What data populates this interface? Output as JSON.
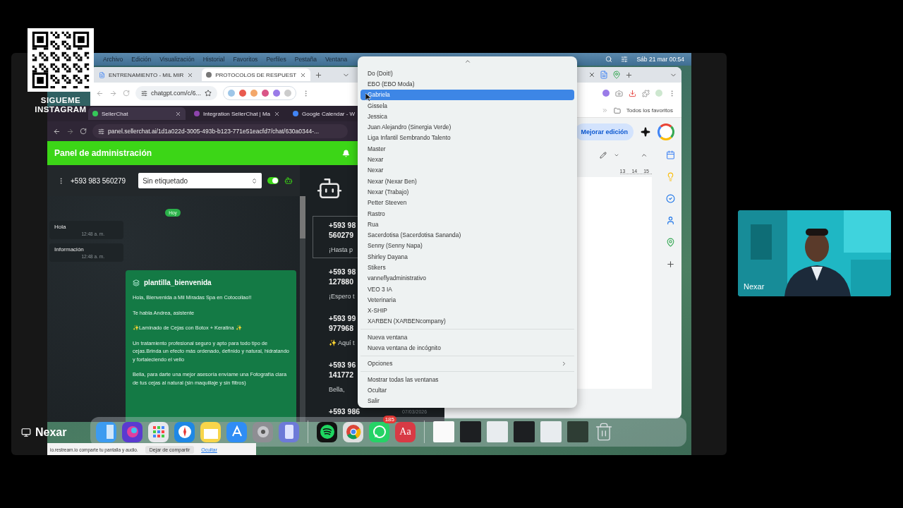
{
  "overlay": {
    "qr_caption": "SIGUEME INSTAGRAM",
    "presenter": "Nexar",
    "webcam": {
      "kind": "picture",
      "name_tag": "Nexar"
    }
  },
  "menu_bar": {
    "items": [
      "Archivo",
      "Edición",
      "Visualización",
      "Historial",
      "Favoritos",
      "Perfiles",
      "Pestaña",
      "Ventana"
    ],
    "clock": "Sáb 21 mar  00:54"
  },
  "back_browser": {
    "tabs": [
      {
        "label": "ENTRENAMIENTO - MIL MIR",
        "selected": false
      },
      {
        "label": "PROTOCOLOS DE RESPUEST",
        "selected": true
      }
    ],
    "url": "chatgpt.com/c/6...",
    "bookmarks": "Todos los favoritos",
    "doc_button": "Mejorar edición",
    "ruler": [
      "13",
      "14",
      "15"
    ]
  },
  "front_browser": {
    "tabs": [
      {
        "label": "SellerChat",
        "selected": true
      },
      {
        "label": "Integration SellerChat | Ma",
        "selected": false
      },
      {
        "label": "Google Calendar - W",
        "selected": false
      }
    ],
    "url": "panel.sellerchat.ai/1d1a022d-3005-493b-b123-771e51eacfd7/chat/630a0344-...",
    "app": {
      "title": "Panel de administración",
      "phone": "+593 983 560279",
      "tag_select": "Sin etiquetado",
      "bot_on": true,
      "day_badge": "Hoy",
      "messages": [
        {
          "text": "Hola",
          "time": "12:48 a. m."
        },
        {
          "text": "Información",
          "time": "12:48 a. m."
        }
      ],
      "template": {
        "name": "plantilla_bienvenida",
        "paragraphs": [
          "Hola, Bienvenida a Mil Miradas Spa en Cotocollao!!",
          "Te habla Andrea, asistente",
          "✨Laminado de Cejas con Botox + Keratina ✨",
          "Un tratamiento profesional seguro y apto para todo tipo de cejas.Brinda un efecto más ordenado, definido y natural, hidratando y fortaleciendo el vello",
          "Bella, para darte una mejor asesoría envíame una Fotografía clara de tus cejas al natural (sin maquillaje y sin filtros)"
        ]
      },
      "contacts": [
        {
          "line_1": "+593 98",
          "line_2": "560279",
          "preview": "¡Hasta p",
          "selected": true
        },
        {
          "line_1": "+593 98",
          "line_2": "127880",
          "preview": "¡Espero t",
          "selected": false
        },
        {
          "line_1": "+593 99",
          "line_2": "977968",
          "preview": "✨ Aquí t",
          "selected": false
        },
        {
          "line_1": "+593 96",
          "line_2": "141772",
          "preview": "Bella,",
          "selected": false
        },
        {
          "line_1": "+593 986",
          "date": "07/03/2026",
          "selected": false
        }
      ]
    }
  },
  "profile_menu": {
    "groups": [
      [
        {
          "label": "Do (Doit!)",
          "selected": false
        },
        {
          "label": "EBO (EBO Moda)",
          "selected": false
        },
        {
          "label": "Gabriela",
          "selected": true
        },
        {
          "label": "Gissela",
          "selected": false
        },
        {
          "label": "Jessica",
          "selected": false
        },
        {
          "label": "Juan Alejandro (Sinergia Verde)",
          "selected": false
        },
        {
          "label": "Liga Infantil Sembrando Talento",
          "selected": false
        },
        {
          "label": "Master",
          "selected": false
        },
        {
          "label": "Nexar",
          "selected": false
        },
        {
          "label": "Nexar",
          "selected": false
        },
        {
          "label": "Nexar (Nexar Ben)",
          "selected": false
        },
        {
          "label": "Nexar (Trabajo)",
          "selected": false
        },
        {
          "label": "Petter Steeven",
          "selected": false
        },
        {
          "label": "Rastro",
          "selected": false
        },
        {
          "label": "Rua",
          "selected": false
        },
        {
          "label": "Sacerdotisa (Sacerdotisa Sananda)",
          "selected": false
        },
        {
          "label": "Senny (Senny Napa)",
          "selected": false
        },
        {
          "label": "Shirley Dayana",
          "selected": false
        },
        {
          "label": "Stikers",
          "selected": false
        },
        {
          "label": "vanneflyadministrativo",
          "selected": false
        },
        {
          "label": "VEO 3 IA",
          "selected": false
        },
        {
          "label": "Veterinaria",
          "selected": false
        },
        {
          "label": "X-SHIP",
          "selected": false
        },
        {
          "label": "XARBEN (XARBENcompany)",
          "selected": false
        }
      ],
      [
        {
          "label": "Nueva ventana",
          "selected": false
        },
        {
          "label": "Nueva ventana de incógnito",
          "selected": false
        }
      ],
      [
        {
          "label": "Opciones",
          "selected": false,
          "submenu": true
        }
      ],
      [
        {
          "label": "Mostrar todas las ventanas",
          "selected": false
        },
        {
          "label": "Ocultar",
          "selected": false
        },
        {
          "label": "Salir",
          "selected": false
        }
      ]
    ]
  },
  "dock": {
    "items": [
      {
        "kind": "finder"
      },
      {
        "kind": "siri"
      },
      {
        "kind": "launchpad"
      },
      {
        "kind": "safari"
      },
      {
        "kind": "notes"
      },
      {
        "kind": "appstore"
      },
      {
        "kind": "settings"
      },
      {
        "kind": "simulator"
      },
      {
        "kind": "separator"
      },
      {
        "kind": "spotify"
      },
      {
        "kind": "chrome"
      },
      {
        "kind": "whatsapp",
        "badge": "185"
      },
      {
        "kind": "dictionary",
        "glyph": "Aa"
      },
      {
        "kind": "separator"
      },
      {
        "kind": "document"
      },
      {
        "kind": "window-dark"
      },
      {
        "kind": "window-light"
      },
      {
        "kind": "window-dark"
      },
      {
        "kind": "window-light"
      },
      {
        "kind": "window-mixed"
      },
      {
        "kind": "trash"
      }
    ]
  },
  "share_bar": {
    "message": "io.restream.io comparte tu pantalla y audio.",
    "stop_button": "Dejar de compartir",
    "hide_link": "Ocultar"
  }
}
